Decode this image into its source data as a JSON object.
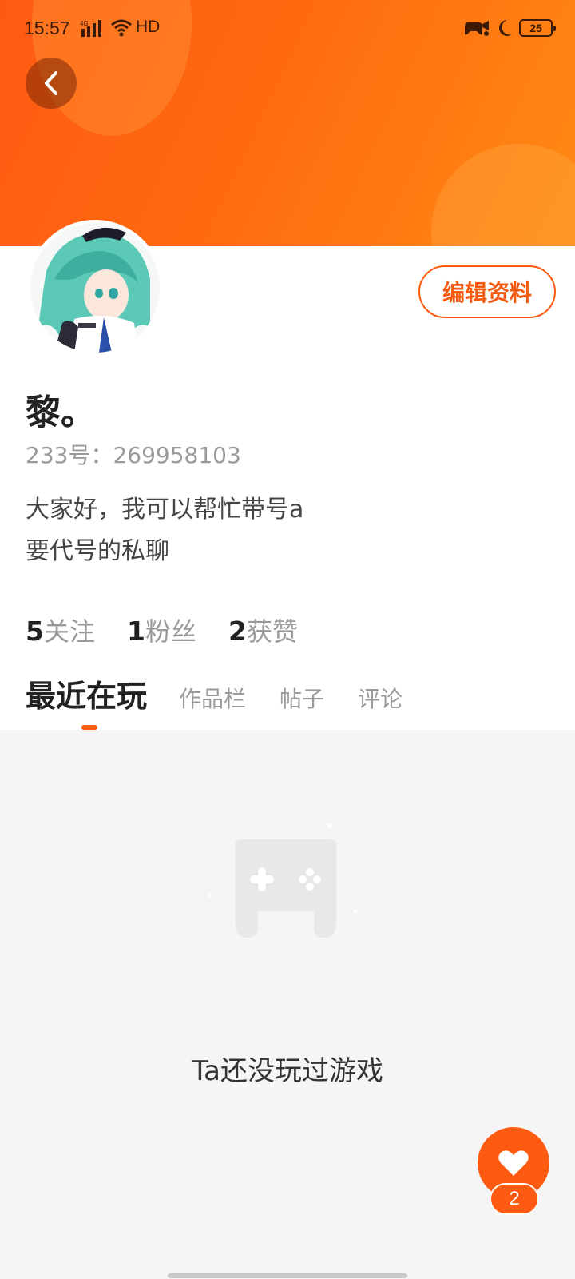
{
  "status_bar": {
    "time": "15:57",
    "network": "HD",
    "battery": "25"
  },
  "profile": {
    "username": "黎。",
    "account_id": "233号：269958103",
    "bio_line1": "大家好，我可以帮忙带号a",
    "bio_line2": "要代号的私聊",
    "edit_button_label": "编辑资料"
  },
  "stats": [
    {
      "count": "5",
      "label": "关注"
    },
    {
      "count": "1",
      "label": "粉丝"
    },
    {
      "count": "2",
      "label": "获赞"
    }
  ],
  "tabs": [
    {
      "label": "最近在玩",
      "active": true
    },
    {
      "label": "作品栏",
      "active": false
    },
    {
      "label": "帖子",
      "active": false
    },
    {
      "label": "评论",
      "active": false
    }
  ],
  "empty_state": {
    "message": "Ta还没玩过游戏",
    "icon": "gamepad-icon"
  },
  "like_fab": {
    "count": "2",
    "icon": "heart-icon"
  },
  "colors": {
    "accent": "#ff5a12",
    "banner_start": "#ff5a12",
    "banner_end": "#ff8a14"
  }
}
